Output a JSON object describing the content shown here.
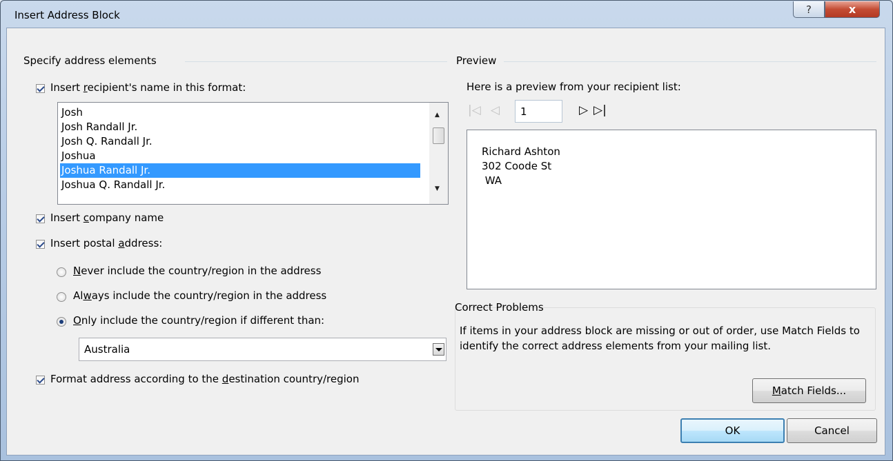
{
  "window": {
    "title": "Insert Address Block",
    "help_glyph": "?",
    "close_glyph": "x"
  },
  "left": {
    "group_title": "Specify address elements",
    "recipient_name": {
      "checked": true,
      "label_pre": "Insert ",
      "label_ul": "r",
      "label_post": "ecipient's name in this format:",
      "formats": [
        "Josh",
        "Josh Randall Jr.",
        "Josh Q. Randall Jr.",
        "Joshua",
        "Joshua Randall Jr.",
        "Joshua Q. Randall Jr."
      ],
      "selected_index": 4
    },
    "company_name": {
      "checked": true,
      "label_pre": "Insert ",
      "label_ul": "c",
      "label_post": "ompany name"
    },
    "postal_address": {
      "checked": true,
      "label_pre": "Insert postal ",
      "label_ul": "a",
      "label_post": "ddress:"
    },
    "country_options": [
      {
        "pre": "",
        "ul": "N",
        "post": "ever include the country/region in the address",
        "checked": false
      },
      {
        "pre": "Al",
        "ul": "w",
        "post": "ays include the country/region in the address",
        "checked": false
      },
      {
        "pre": "",
        "ul": "O",
        "post": "nly include the country/region if different than:",
        "checked": true
      }
    ],
    "country_select": {
      "value": "Australia"
    },
    "format_destination": {
      "checked": true,
      "label_pre": "Format address according to the ",
      "label_ul": "d",
      "label_post": "estination country/region"
    }
  },
  "preview": {
    "group_title": "Preview",
    "caption": "Here is a preview from your recipient list:",
    "nav": {
      "first": "⏮",
      "prev": "◁",
      "next": "▷",
      "last": "⏭",
      "first_glyph": "|◁",
      "last_glyph": "▷|"
    },
    "record": "1",
    "address_lines": [
      "Richard Ashton",
      "302 Coode St",
      " WA"
    ]
  },
  "correct_problems": {
    "title": "Correct Problems",
    "text": "If items in your address block are missing or out of order, use Match Fields to identify the correct address elements from your mailing list.",
    "match_fields_ul": "M",
    "match_fields_post": "atch Fields..."
  },
  "buttons": {
    "ok": "OK",
    "cancel": "Cancel"
  }
}
